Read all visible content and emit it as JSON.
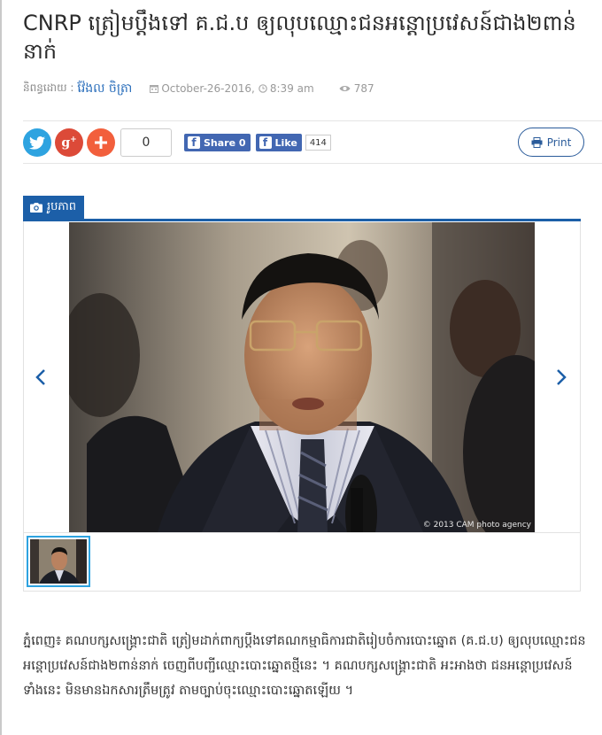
{
  "article": {
    "title": "CNRP ត្រៀមប្ដឹងទៅ គ.ជ.ប ឲ្យលុបឈ្មោះជនអន្តោប្រវេសន៍ជាង២ពាន់នាក់",
    "author_label": "និពន្ធដោយ :",
    "author": "វ៉ែងល ចិត្រា",
    "date": "October-26-2016,",
    "time": "8:39 am",
    "views": "787"
  },
  "share": {
    "count": "0",
    "facebook_share_label": "Share 0",
    "facebook_like_label": "Like",
    "facebook_like_count": "414",
    "print_label": "Print"
  },
  "gallery": {
    "tab_label": "រូបភាព",
    "photo_credit": "© 2013 CAM photo agency"
  },
  "body": {
    "paragraph": "ភ្នំពេញ៖ គណបក្សសង្គ្រោះជាតិ ត្រៀមដាក់ពាក្យប្ដឹងទៅគណកម្មាធិការជាតិរៀបចំការបោះឆ្នោត (គ.ជ.ប) ឲ្យលុបឈ្មោះជនអន្តោប្រវេសន៍ជាង២ពាន់នាក់ ចេញពីបញ្ជីឈ្មោះបោះឆ្នោតថ្មីនេះ ។ គណបក្សសង្គ្រោះជាតិ អះអាងថា ជនអន្តោប្រវេសន៍ទាំងនេះ មិនមានឯកសារត្រឹមត្រូវ តាមច្បាប់ចុះឈ្មោះបោះឆ្នោតឡើយ ។"
  },
  "colors": {
    "accent": "#1c5fa8",
    "twitter": "#2ea3e0",
    "google_plus": "#dc4a38",
    "add": "#f25f3c",
    "facebook": "#4267b2"
  },
  "icons": [
    "calendar-icon",
    "clock-icon",
    "eye-icon",
    "twitter-icon",
    "google-plus-icon",
    "plus-icon",
    "facebook-icon",
    "print-icon",
    "camera-icon",
    "chevron-left-icon",
    "chevron-right-icon"
  ]
}
